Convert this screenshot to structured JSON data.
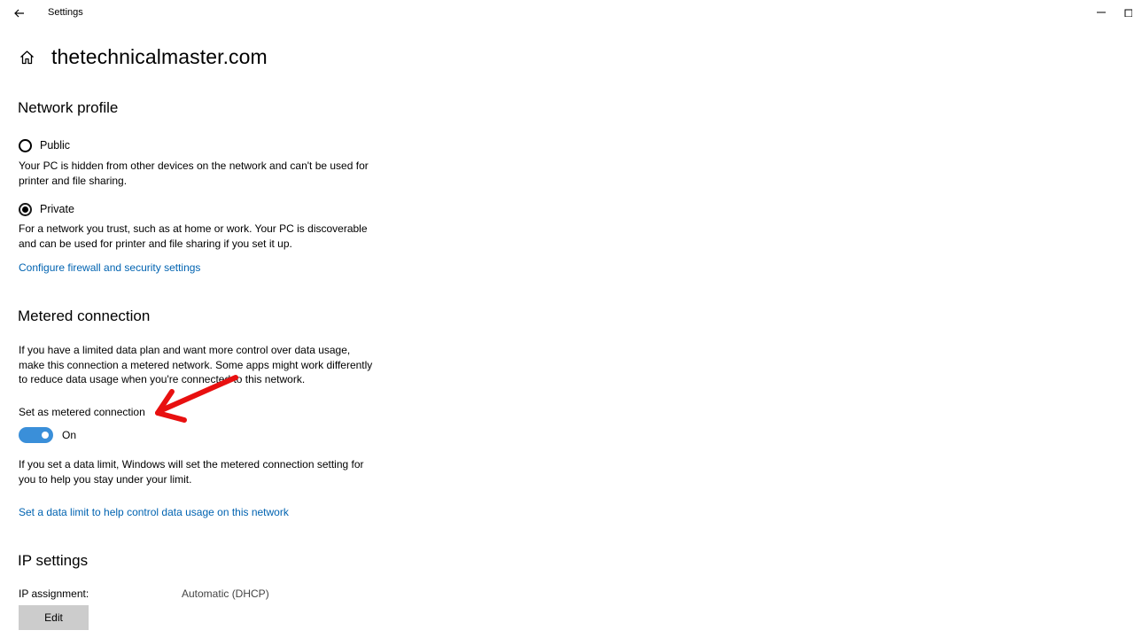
{
  "window": {
    "title": "Settings",
    "back_icon": "arrow-left-icon",
    "minimize_icon": "minimize-icon"
  },
  "header": {
    "home_icon": "home-icon",
    "title": "thetechnicalmaster.com"
  },
  "network_profile": {
    "title": "Network profile",
    "options": [
      {
        "label": "Public",
        "selected": false,
        "description": "Your PC is hidden from other devices on the network and can't be used for printer and file sharing."
      },
      {
        "label": "Private",
        "selected": true,
        "description": "For a network you trust, such as at home or work. Your PC is discoverable and can be used for printer and file sharing if you set it up."
      }
    ],
    "firewall_link": "Configure firewall and security settings"
  },
  "metered": {
    "title": "Metered connection",
    "description": "If you have a limited data plan and want more control over data usage, make this connection a metered network. Some apps might work differently to reduce data usage when you're connected to this network.",
    "toggle_label": "Set as metered connection",
    "toggle_state": "On",
    "toggle_on": true,
    "data_limit_note": "If you set a data limit, Windows will set the metered connection setting for you to help you stay under your limit.",
    "data_limit_link": "Set a data limit to help control data usage on this network"
  },
  "ip_settings": {
    "title": "IP settings",
    "assignment_label": "IP assignment:",
    "assignment_value": "Automatic (DHCP)",
    "edit_label": "Edit"
  },
  "colors": {
    "accent": "#0063b1",
    "toggle_on": "#3a8fd9",
    "annotation_arrow": "#e81010",
    "button_bg": "#cccccc"
  }
}
